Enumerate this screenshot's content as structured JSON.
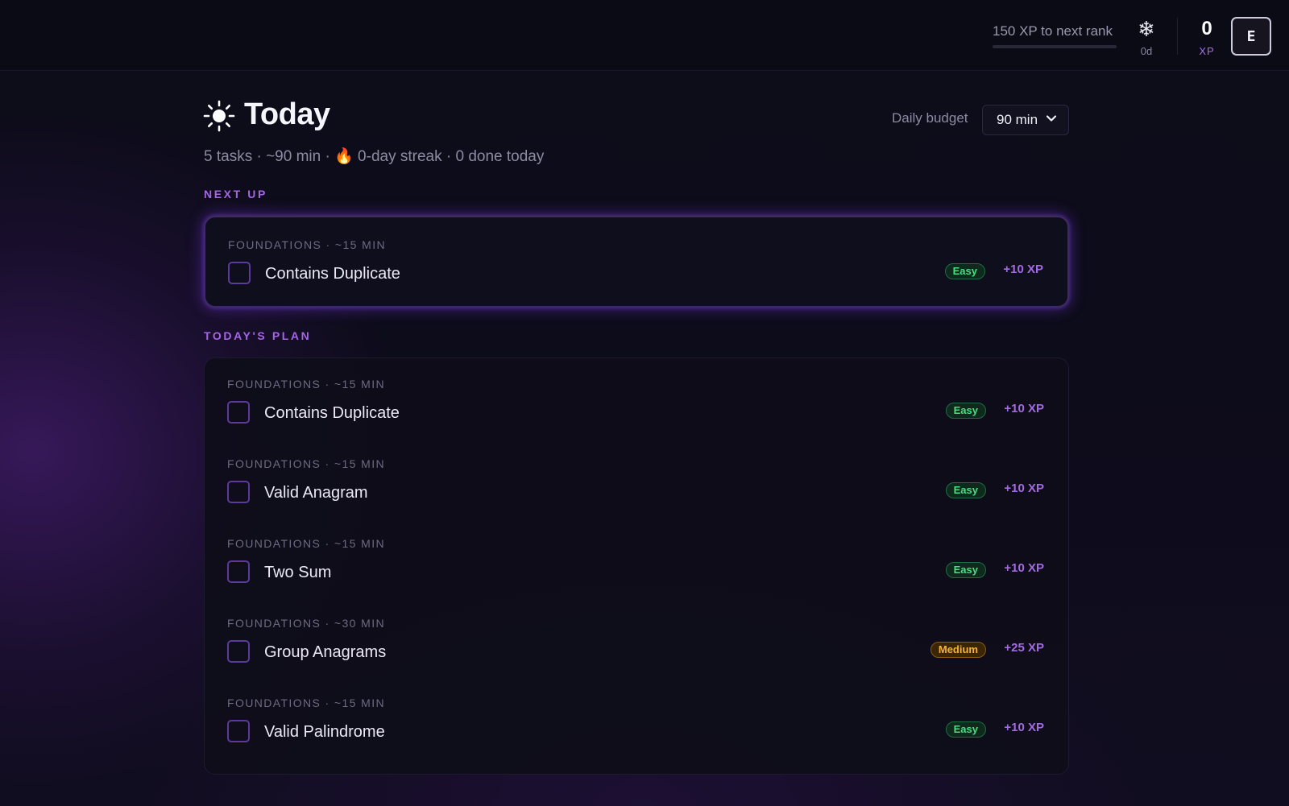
{
  "topbar": {
    "rank_progress_text": "150 XP to next rank",
    "rank_progress_fraction": 0,
    "freeze_icon": "snowflake-icon",
    "freeze_value": "0d",
    "xp_value": "0",
    "xp_label": "XP",
    "avatar_initial": "E"
  },
  "header": {
    "title": "Today",
    "title_icon": "sun-icon",
    "subtitle_part1": "5 tasks · ~90 min · ",
    "subtitle_flame": "🔥",
    "subtitle_part2": " 0-day streak · 0 done today",
    "budget_label": "Daily budget",
    "budget_value": "90 min"
  },
  "next_up": {
    "label": "NEXT UP",
    "task": {
      "meta": "FOUNDATIONS · ~15 MIN",
      "name": "Contains Duplicate",
      "difficulty": "Easy",
      "xp": "+10 XP"
    }
  },
  "plan": {
    "label": "TODAY'S PLAN",
    "tasks": [
      {
        "meta": "FOUNDATIONS · ~15 MIN",
        "name": "Contains Duplicate",
        "difficulty": "Easy",
        "xp": "+10 XP"
      },
      {
        "meta": "FOUNDATIONS · ~15 MIN",
        "name": "Valid Anagram",
        "difficulty": "Easy",
        "xp": "+10 XP"
      },
      {
        "meta": "FOUNDATIONS · ~15 MIN",
        "name": "Two Sum",
        "difficulty": "Easy",
        "xp": "+10 XP"
      },
      {
        "meta": "FOUNDATIONS · ~30 MIN",
        "name": "Group Anagrams",
        "difficulty": "Medium",
        "xp": "+25 XP"
      },
      {
        "meta": "FOUNDATIONS · ~15 MIN",
        "name": "Valid Palindrome",
        "difficulty": "Easy",
        "xp": "+10 XP"
      }
    ]
  },
  "colors": {
    "accent": "#a566e6",
    "easy": "#4ade80",
    "medium": "#f7b23b",
    "background": "#0d0c19"
  }
}
